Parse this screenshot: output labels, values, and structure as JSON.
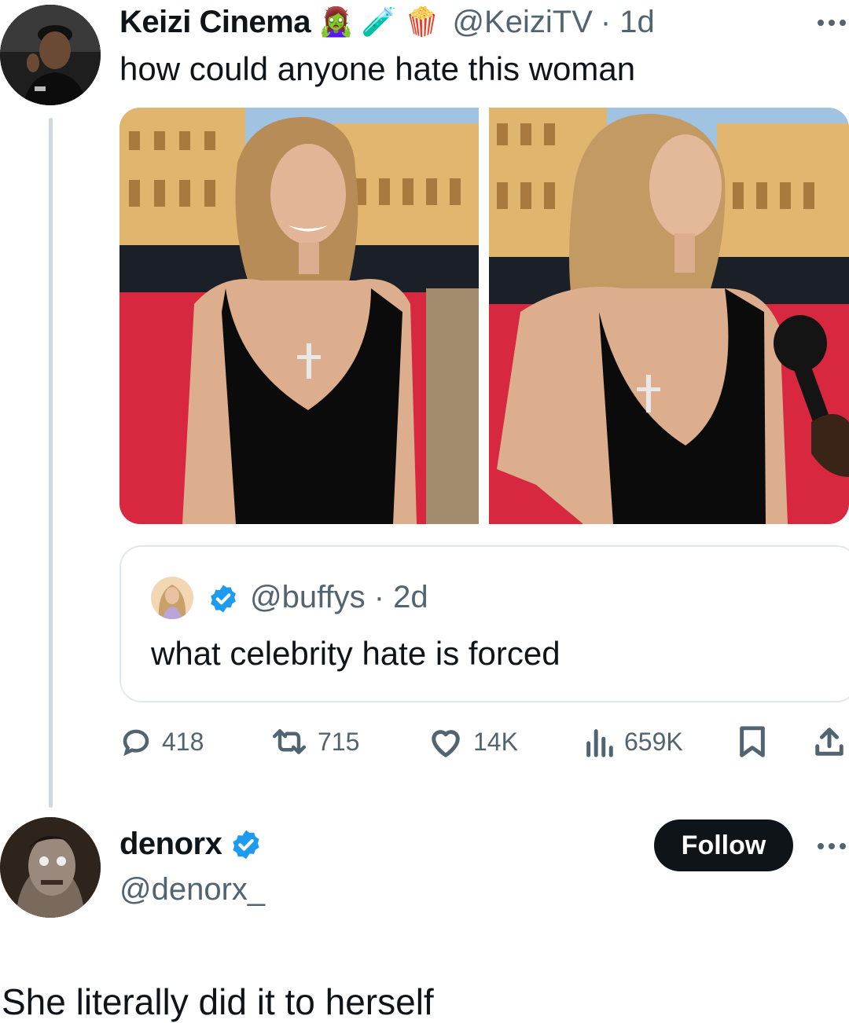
{
  "tweet": {
    "author_name": "Keizi Cinema",
    "author_emojis": [
      "🧟‍♀️",
      "🧪",
      "🍿"
    ],
    "author_handle": "@KeiziTV",
    "time": "· 1d",
    "text": "how could anyone hate this woman",
    "quote": {
      "handle": "@buffys",
      "time": "· 2d",
      "text": "what celebrity hate is forced"
    },
    "stats": {
      "replies": "418",
      "retweets": "715",
      "likes": "14K",
      "views": "659K"
    }
  },
  "reply_user": {
    "name": "denorx",
    "handle": "@denorx_",
    "follow_label": "Follow",
    "text": "She literally did it to herself"
  },
  "colors": {
    "verified": "#1d9bf0",
    "muted": "#536471",
    "red_carpet": "#d8283f"
  }
}
